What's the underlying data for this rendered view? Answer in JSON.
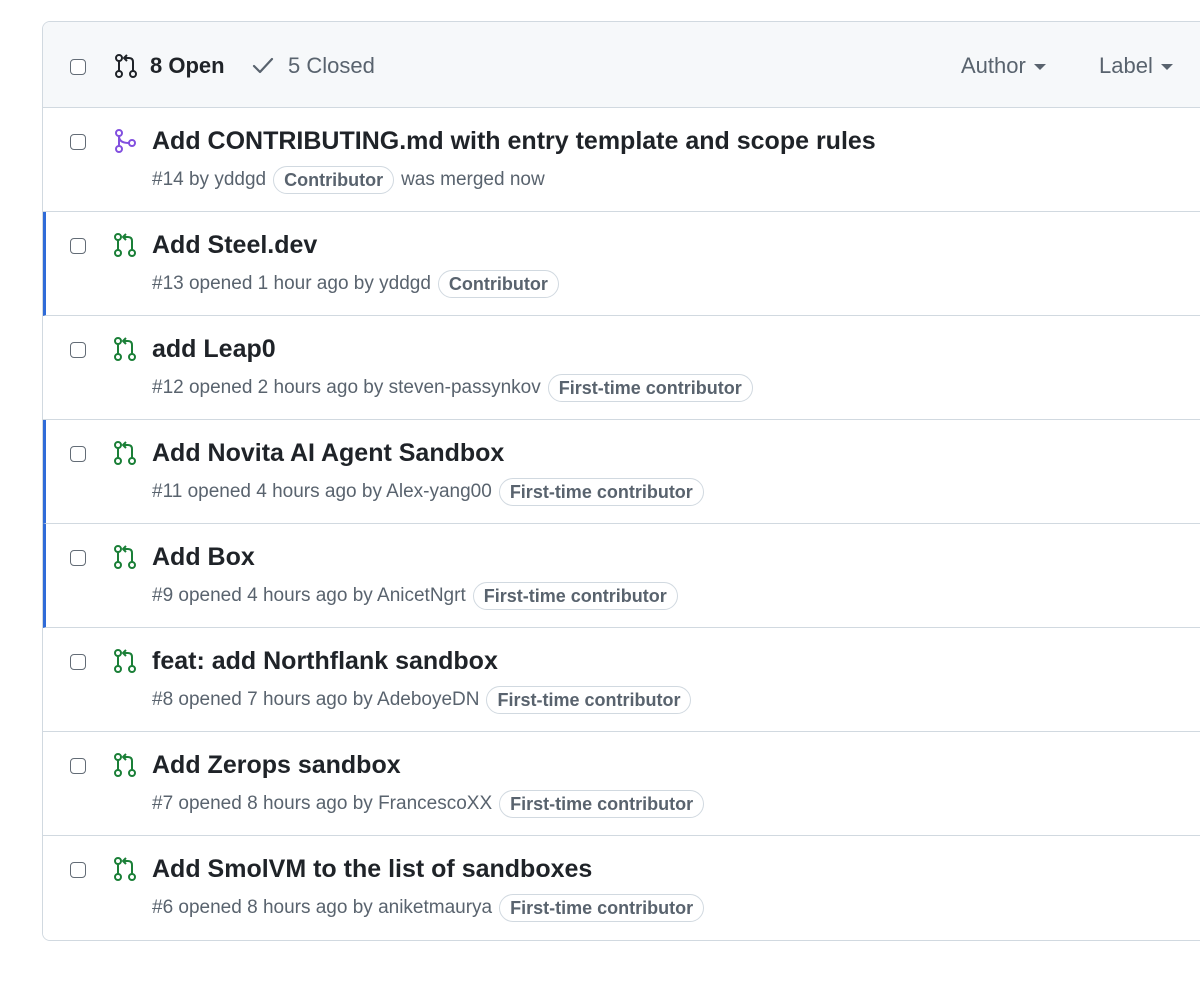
{
  "header": {
    "open_label": "8 Open",
    "closed_label": "5 Closed",
    "author_filter": "Author",
    "label_filter": "Label"
  },
  "icons": {
    "open": "git-pull-request-icon",
    "merged": "git-merge-icon",
    "check": "check-icon"
  },
  "colors": {
    "open": "#1a7f37",
    "merged": "#8250df",
    "accent": "#2f6bd8"
  },
  "pulls": [
    {
      "title": "Add CONTRIBUTING.md with entry template and scope rules",
      "meta": "#14 by yddgd",
      "badge": "Contributor",
      "after": "was merged now",
      "state": "merged",
      "accent": false
    },
    {
      "title": "Add Steel.dev",
      "meta": "#13 opened 1 hour ago by yddgd",
      "badge": "Contributor",
      "after": "",
      "state": "open",
      "accent": true
    },
    {
      "title": "add Leap0",
      "meta": "#12 opened 2 hours ago by steven-passynkov",
      "badge": "First-time contributor",
      "after": "",
      "state": "open",
      "accent": false
    },
    {
      "title": "Add Novita AI Agent Sandbox",
      "meta": "#11 opened 4 hours ago by Alex-yang00",
      "badge": "First-time contributor",
      "after": "",
      "state": "open",
      "accent": true
    },
    {
      "title": "Add Box",
      "meta": "#9 opened 4 hours ago by AnicetNgrt",
      "badge": "First-time contributor",
      "after": "",
      "state": "open",
      "accent": true
    },
    {
      "title": "feat: add Northflank sandbox",
      "meta": "#8 opened 7 hours ago by AdeboyeDN",
      "badge": "First-time contributor",
      "after": "",
      "state": "open",
      "accent": false
    },
    {
      "title": "Add Zerops sandbox",
      "meta": "#7 opened 8 hours ago by FrancescoXX",
      "badge": "First-time contributor",
      "after": "",
      "state": "open",
      "accent": false
    },
    {
      "title": "Add SmolVM to the list of sandboxes",
      "meta": "#6 opened 8 hours ago by aniketmaurya",
      "badge": "First-time contributor",
      "after": "",
      "state": "open",
      "accent": false
    }
  ]
}
